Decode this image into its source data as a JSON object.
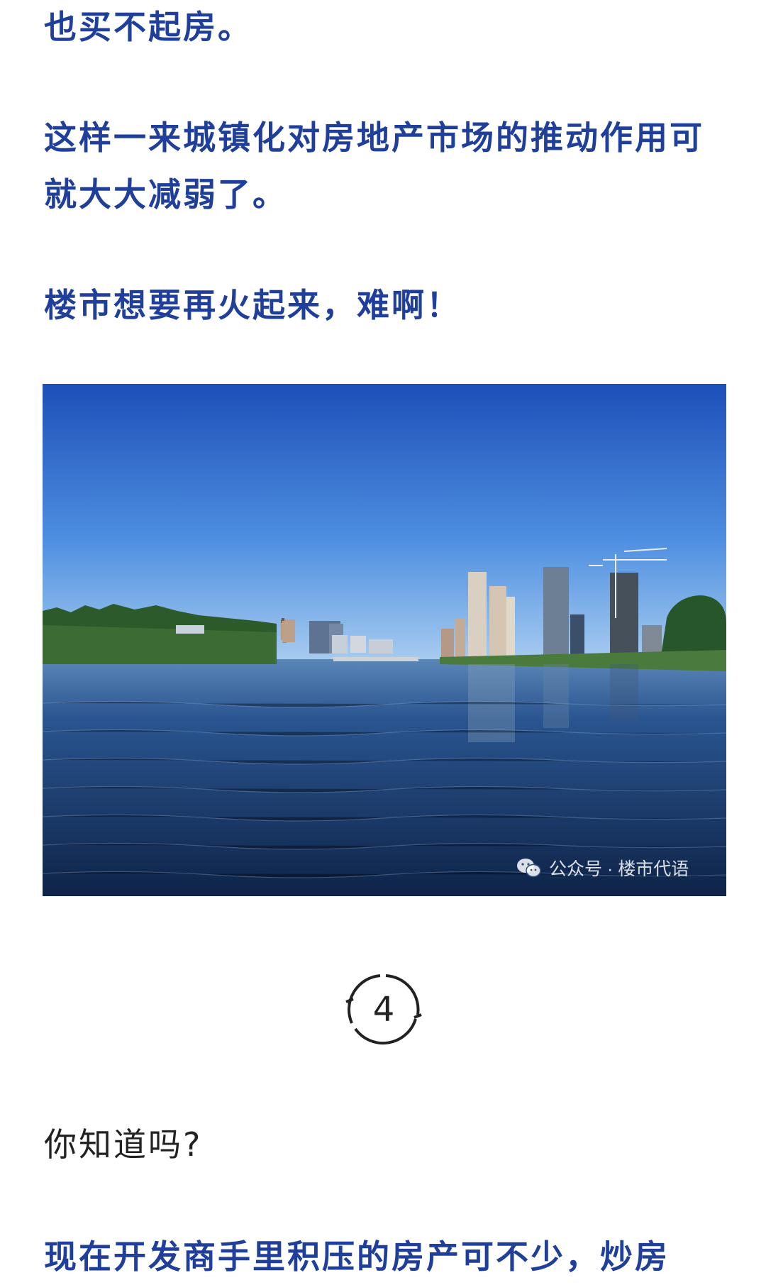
{
  "article": {
    "para1": "也买不起房。",
    "para2": "这样一来城镇化对房地产市场的推动作用可就大大减弱了。",
    "para3": "楼市想要再火起来，难啊！",
    "image": {
      "watermark": "公众号 · 楼市代语",
      "icon": "wechat-icon"
    },
    "section_number": "4",
    "para4": "你知道吗?",
    "para5": "现在开发商手里积压的房产可不少，炒房"
  },
  "colors": {
    "emphasis_text": "#1f3f9b",
    "body_text": "#222222",
    "background": "#ffffff"
  }
}
